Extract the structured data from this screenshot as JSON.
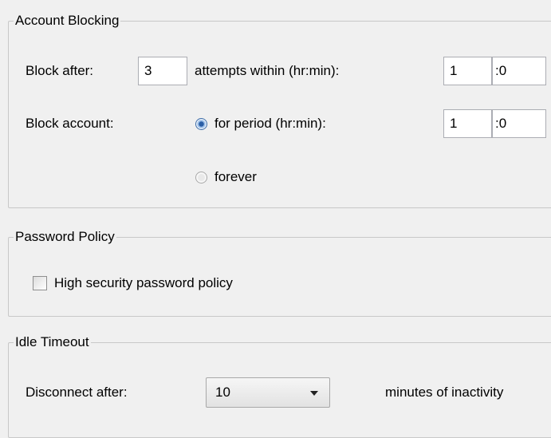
{
  "account_blocking": {
    "legend": "Account Blocking",
    "block_after_label": "Block after:",
    "attempts_value": "3",
    "attempts_within_label": "attempts within (hr:min):",
    "within_hours": "1",
    "within_minutes": "0",
    "block_account_label": "Block account:",
    "for_period_label": "for period (hr:min):",
    "period_hours": "1",
    "period_minutes": "0",
    "forever_label": "forever",
    "selected_option": "for period (hr:min):"
  },
  "password_policy": {
    "legend": "Password Policy",
    "high_security_label": "High security password policy",
    "high_security_checked": false
  },
  "idle_timeout": {
    "legend": "Idle Timeout",
    "disconnect_after_label": "Disconnect after:",
    "minutes_value": "10",
    "minutes_suffix": "minutes of inactivity"
  },
  "colors": {
    "background": "#f0f0f0",
    "groupbox_border": "#c8c8c8",
    "radio_selected": "#2a5ea6"
  }
}
